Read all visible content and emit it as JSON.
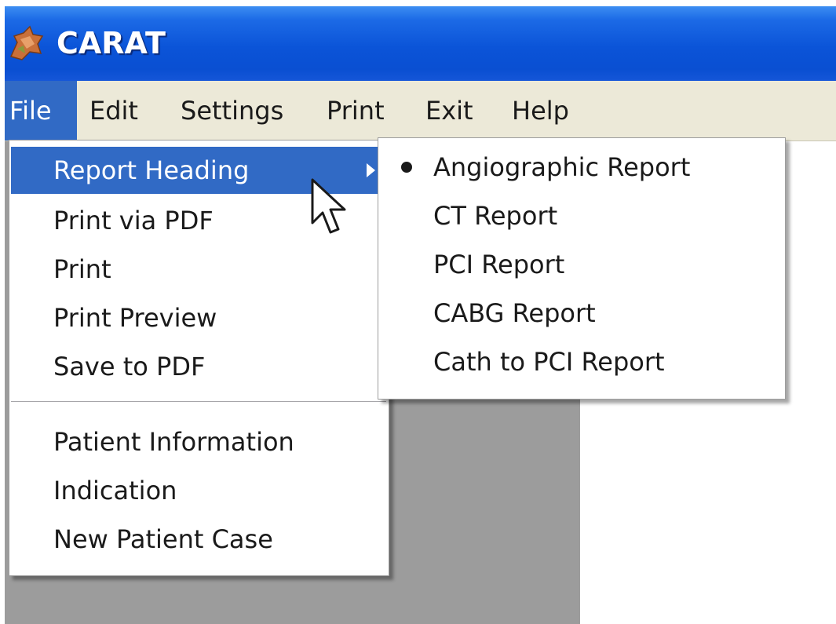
{
  "window": {
    "title": "CARAT",
    "icon": "app-logo-icon"
  },
  "menubar": {
    "items": [
      {
        "label": "File",
        "active": true
      },
      {
        "label": "Edit"
      },
      {
        "label": "Settings"
      },
      {
        "label": "Print"
      },
      {
        "label": "Exit"
      },
      {
        "label": "Help"
      }
    ]
  },
  "file_menu": {
    "items": [
      {
        "label": "Report Heading",
        "highlighted": true,
        "submenu": true
      },
      {
        "label": "Print via PDF"
      },
      {
        "label": "Print"
      },
      {
        "label": "Print Preview"
      },
      {
        "label": "Save to PDF"
      },
      {
        "label": "Patient Information"
      },
      {
        "label": "Indication"
      },
      {
        "label": "New Patient Case"
      }
    ]
  },
  "report_heading_submenu": {
    "items": [
      {
        "label": "Angiographic Report",
        "selected": true
      },
      {
        "label": "CT Report"
      },
      {
        "label": "PCI Report"
      },
      {
        "label": "CABG Report"
      },
      {
        "label": "Cath to PCI Report"
      }
    ]
  },
  "colors": {
    "titlebar": "#0b54d8",
    "menubar": "#ece9d8",
    "highlight": "#316ac5",
    "client_area": "#9c9c9c"
  }
}
